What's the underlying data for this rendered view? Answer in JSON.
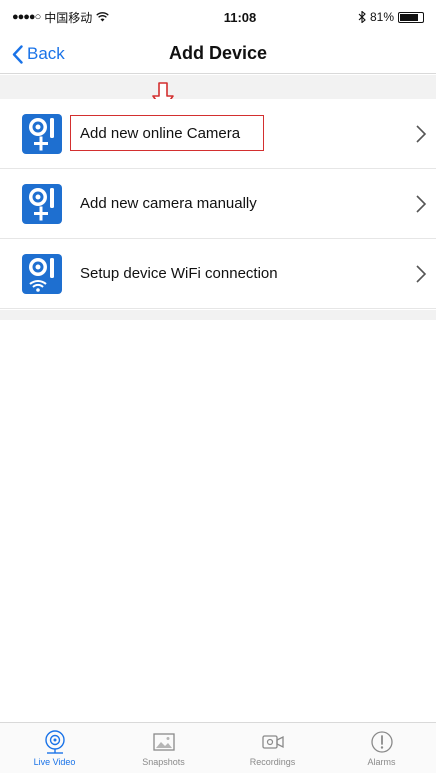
{
  "status_bar": {
    "carrier": "中国移动",
    "time": "11:08",
    "battery": "81%",
    "battery_level": 0.81
  },
  "nav": {
    "back_label": "Back",
    "title": "Add Device"
  },
  "rows": [
    {
      "label": "Add new online Camera",
      "icon": "camera-add-icon",
      "highlighted": true
    },
    {
      "label": "Add new camera manually",
      "icon": "camera-add-icon",
      "highlighted": false
    },
    {
      "label": "Setup device WiFi connection",
      "icon": "camera-wifi-icon",
      "highlighted": false
    }
  ],
  "tabs": [
    {
      "label": "Live Video",
      "icon": "live-video-icon",
      "active": true
    },
    {
      "label": "Snapshots",
      "icon": "snapshots-icon",
      "active": false
    },
    {
      "label": "Recordings",
      "icon": "recordings-icon",
      "active": false
    },
    {
      "label": "Alarms",
      "icon": "alarms-icon",
      "active": false
    }
  ],
  "colors": {
    "accent": "#1a73e8",
    "highlight": "#d32f2f",
    "inactive": "#8a8a8a"
  }
}
